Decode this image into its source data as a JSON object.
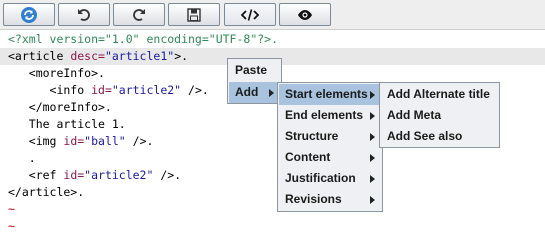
{
  "toolbar": {
    "buttons": [
      {
        "name": "refresh-button",
        "icon": "refresh-icon"
      },
      {
        "name": "undo-button",
        "icon": "undo-icon"
      },
      {
        "name": "redo-button",
        "icon": "redo-icon"
      },
      {
        "name": "save-button",
        "icon": "floppy-disk-icon"
      },
      {
        "name": "source-view-button",
        "icon": "code-tags-icon"
      },
      {
        "name": "preview-button",
        "icon": "eye-icon"
      }
    ]
  },
  "editor": {
    "lines": [
      {
        "id": "l1",
        "parts": [
          {
            "c": "pi",
            "t": "<?xml version=\"1.0\" encoding=\"UTF-8\"?>."
          }
        ]
      },
      {
        "id": "l2",
        "hl": true,
        "parts": [
          {
            "c": "tag",
            "t": "<article "
          },
          {
            "c": "attr",
            "t": "desc="
          },
          {
            "c": "val",
            "t": "\"article1\""
          },
          {
            "c": "tag",
            "t": ">."
          }
        ]
      },
      {
        "id": "l3",
        "parts": [
          {
            "c": "tag",
            "t": "   <moreInfo>."
          }
        ]
      },
      {
        "id": "l4",
        "parts": [
          {
            "c": "tag",
            "t": "      <info "
          },
          {
            "c": "attr",
            "t": "id="
          },
          {
            "c": "val",
            "t": "\"article2\""
          },
          {
            "c": "tag",
            "t": " />."
          }
        ]
      },
      {
        "id": "l5",
        "parts": [
          {
            "c": "tag",
            "t": "   </moreInfo>."
          }
        ]
      },
      {
        "id": "l6",
        "parts": [
          {
            "c": "txt",
            "t": "   The article 1."
          }
        ]
      },
      {
        "id": "l7",
        "parts": [
          {
            "c": "tag",
            "t": "   <img "
          },
          {
            "c": "attr",
            "t": "id="
          },
          {
            "c": "val",
            "t": "\"ball\""
          },
          {
            "c": "tag",
            "t": " />."
          }
        ]
      },
      {
        "id": "l8",
        "parts": [
          {
            "c": "dot",
            "t": "   ."
          }
        ]
      },
      {
        "id": "l9",
        "parts": [
          {
            "c": "tag",
            "t": "   <ref "
          },
          {
            "c": "attr",
            "t": "id="
          },
          {
            "c": "val",
            "t": "\"article2\""
          },
          {
            "c": "tag",
            "t": " />."
          }
        ]
      },
      {
        "id": "l10",
        "parts": [
          {
            "c": "tag",
            "t": "</article>."
          }
        ]
      },
      {
        "id": "l11",
        "parts": [
          {
            "c": "tilde",
            "t": "~"
          }
        ]
      },
      {
        "id": "l12",
        "parts": [
          {
            "c": "tilde",
            "t": "~"
          }
        ]
      }
    ]
  },
  "context_menu": {
    "items": [
      {
        "label": "Paste",
        "submenu": false
      },
      {
        "label": "Add",
        "submenu": true,
        "selected": true
      }
    ]
  },
  "add_submenu": {
    "items": [
      {
        "label": "Start elements",
        "selected": true
      },
      {
        "label": "End elements"
      },
      {
        "label": "Structure"
      },
      {
        "label": "Content"
      },
      {
        "label": "Justification"
      },
      {
        "label": "Revisions"
      }
    ]
  },
  "start_elements_submenu": {
    "items": [
      {
        "label": "Add Alternate title"
      },
      {
        "label": "Add Meta"
      },
      {
        "label": "Add See also"
      }
    ]
  },
  "colors": {
    "selection": "#a9c3df",
    "menu_bg": "#eef0f3",
    "pi": "#2e8b57",
    "attr": "#8b1a4b",
    "value": "#1a1aa6",
    "tilde": "#c00000"
  }
}
